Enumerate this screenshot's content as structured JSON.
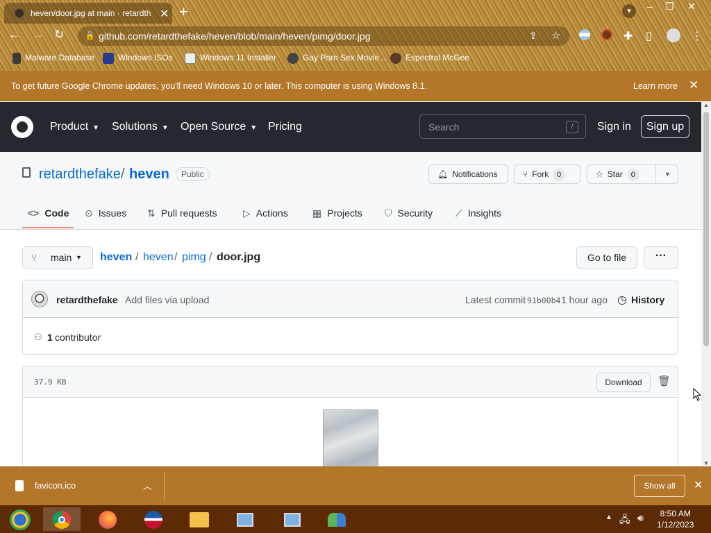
{
  "browser": {
    "tab_title": "heven/door.jpg at main · retardth",
    "url": "github.com/retardthefake/heven/blob/main/heven/pimg/door.jpg",
    "bookmarks": [
      "Malware Database",
      "Windows ISOs",
      "Windows 11 Installer",
      "Gay Porn Sex Movie...",
      "Espectral McGee"
    ],
    "update_bar": {
      "message": "To get future Google Chrome updates, you'll need Windows 10 or later. This computer is using Windows 8.1.",
      "learn_more": "Learn more"
    }
  },
  "github_header": {
    "nav": [
      "Product",
      "Solutions",
      "Open Source",
      "Pricing"
    ],
    "search_placeholder": "Search",
    "search_shortcut": "/",
    "sign_in": "Sign in",
    "sign_up": "Sign up"
  },
  "repo": {
    "owner": "retardthefake",
    "separator": "/",
    "name": "heven",
    "visibility": "Public",
    "actions": {
      "notifications": "Notifications",
      "fork": "Fork",
      "fork_count": "0",
      "star": "Star",
      "star_count": "0"
    },
    "tabs": [
      "Code",
      "Issues",
      "Pull requests",
      "Actions",
      "Projects",
      "Security",
      "Insights"
    ]
  },
  "file_nav": {
    "branch": "main",
    "path": [
      "heven",
      "heven",
      "pimg"
    ],
    "filename": "door.jpg",
    "go_to_file": "Go to file",
    "more": "···"
  },
  "commit": {
    "author": "retardthefake",
    "message": "Add files via upload",
    "latest_label": "Latest commit",
    "sha": "91b00b4",
    "time": "1 hour ago",
    "history": "History",
    "contributors_count": "1",
    "contributors_label": "contributor"
  },
  "file": {
    "size": "37.9 KB",
    "download": "Download"
  },
  "download_bar": {
    "filename": "favicon.ico",
    "show_all": "Show all"
  },
  "taskbar": {
    "time": "8:50 AM",
    "date": "1/12/2023"
  },
  "colors": {
    "chrome_frame": "#b88a3c",
    "update_bar": "#b4772a",
    "github_header": "#24292f",
    "link": "#0969da",
    "active_tab_underline": "#fd8c73",
    "taskbar": "#5c2a05"
  }
}
